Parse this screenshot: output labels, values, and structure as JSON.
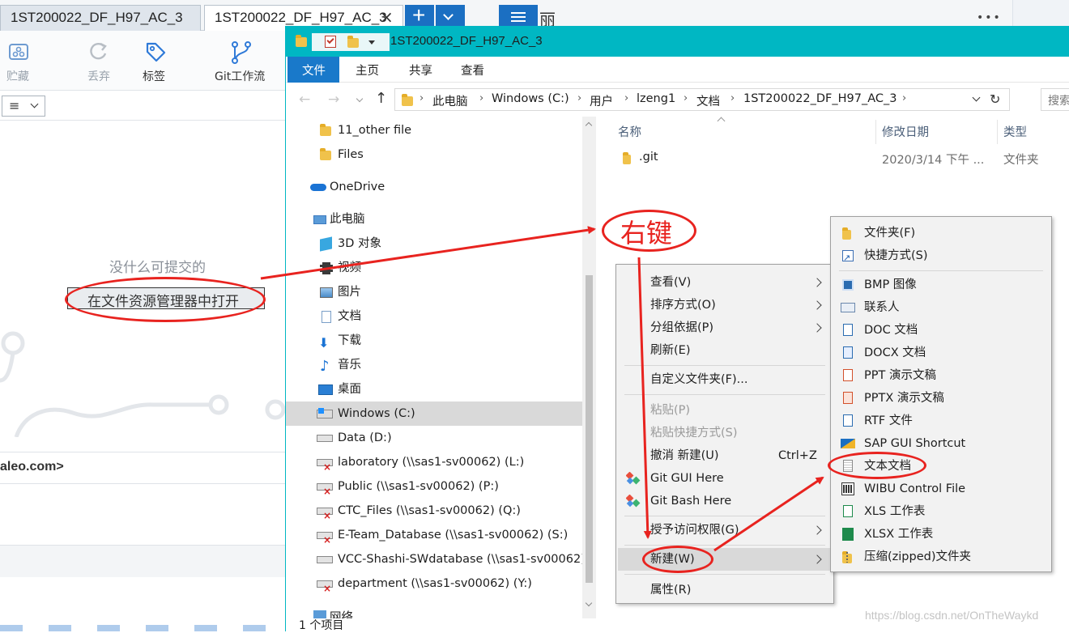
{
  "gitapp": {
    "tabs": [
      "1ST200022_DF_H97_AC_3",
      "1ST200022_DF_H97_AC_3"
    ],
    "tab_close": "×",
    "tab_add": "+",
    "toolbar": [
      "贮藏",
      "丢弃",
      "标签",
      "Git工作流"
    ],
    "view_menu": "≡",
    "nothing_to_commit": "没什么可提交的",
    "open_in_explorer": "在文件资源管理器中打开",
    "email_fragment": "aleo.com>",
    "more_dots": "•••",
    "partial_title": "丽"
  },
  "explorer": {
    "title": "1ST200022_DF_H97_AC_3",
    "ribbon_tabs": [
      "文件",
      "主页",
      "共享",
      "查看"
    ],
    "breadcrumb": [
      "此电脑",
      "Windows (C:)",
      "用户",
      "lzeng1",
      "文档",
      "1ST200022_DF_H97_AC_3"
    ],
    "search_placeholder": "搜索",
    "nav_tree": [
      "11_other file",
      "Files",
      "OneDrive",
      "此电脑",
      "3D 对象",
      "视频",
      "图片",
      "文档",
      "下载",
      "音乐",
      "桌面",
      "Windows (C:)",
      "Data (D:)",
      "laboratory (\\\\sas1-sv00062) (L:)",
      "Public (\\\\sas1-sv00062) (P:)",
      "CTC_Files (\\\\sas1-sv00062) (Q:)",
      "E-Team_Database (\\\\sas1-sv00062) (S:)",
      "VCC-Shashi-SWdatabase (\\\\sas1-sv00062)",
      "department (\\\\sas1-sv00062) (Y:)",
      "网络"
    ],
    "columns": [
      "名称",
      "修改日期",
      "类型"
    ],
    "files": [
      {
        "name": ".git",
        "modified": "2020/3/14 下午 ...",
        "type": "文件夹"
      }
    ],
    "status": "1 个项目"
  },
  "context_menu": {
    "items": [
      "查看(V)",
      "排序方式(O)",
      "分组依据(P)",
      "刷新(E)",
      "自定义文件夹(F)...",
      "粘贴(P)",
      "粘贴快捷方式(S)",
      "撤消 新建(U)",
      "Git GUI Here",
      "Git Bash Here",
      "授予访问权限(G)",
      "新建(W)",
      "属性(R)"
    ],
    "undo_shortcut": "Ctrl+Z"
  },
  "submenu": {
    "items": [
      "文件夹(F)",
      "快捷方式(S)",
      "BMP 图像",
      "联系人",
      "DOC 文档",
      "DOCX 文档",
      "PPT 演示文稿",
      "PPTX 演示文稿",
      "RTF 文件",
      "SAP GUI Shortcut",
      "文本文档",
      "WIBU Control File",
      "XLS 工作表",
      "XLSX 工作表",
      "压缩(zipped)文件夹"
    ]
  },
  "annotation": {
    "label": "右键"
  },
  "watermark": "https://blog.csdn.net/OnTheWaykd",
  "colors": {
    "title_bar": "#00b7c3",
    "ribbon_file_tab": "#1979ca",
    "annotation_red": "#e8231f",
    "menu_bg": "#f2f2f2"
  }
}
